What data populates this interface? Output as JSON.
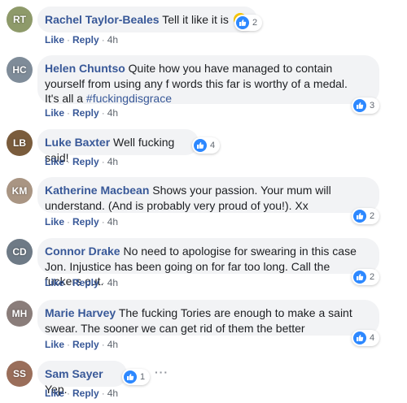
{
  "colors": {
    "link": "#385898",
    "like_blue": "#2d88ff",
    "bubble_bg": "#f2f3f5",
    "meta_gray": "#606770"
  },
  "actions": {
    "like": "Like",
    "reply": "Reply",
    "sep": "·",
    "time": "4h"
  },
  "more_icon": "···",
  "comments": [
    {
      "author": "Rachel Taylor-Beales",
      "text": "Tell it like it is",
      "emoji": "smiling-face-emoji",
      "likes": "2",
      "avatar_color": "#8e9a6a"
    },
    {
      "author": "Helen Chuntso",
      "text": "Quite how you have managed to contain yourself from using any f words this far is worthy of a medal.",
      "text2": "It's all a ",
      "hashtag": "#fuckingdisgrace",
      "likes": "3",
      "avatar_color": "#7f8c99"
    },
    {
      "author": "Luke Baxter",
      "text": "Well fucking said!",
      "likes": "4",
      "avatar_color": "#7a5c3c"
    },
    {
      "author": "Katherine Macbean",
      "text": "Shows your passion. Your mum will understand. (And is probably very proud of you!). Xx",
      "likes": "2",
      "avatar_color": "#a99583"
    },
    {
      "author": "Connor Drake",
      "text": "No need to apologise for swearing in this case Jon. Injustice has been going on for far too long. Call the fuckers out.",
      "likes": "2",
      "avatar_color": "#6e7a86"
    },
    {
      "author": "Marie Harvey",
      "text": "The fucking Tories are enough to make a saint swear. The sooner we can get rid of them the better",
      "likes": "4",
      "avatar_color": "#8a7d7a"
    },
    {
      "author": "Sam Sayer",
      "text": "Yep.",
      "likes": "1",
      "avatar_color": "#9a6e5a"
    }
  ]
}
